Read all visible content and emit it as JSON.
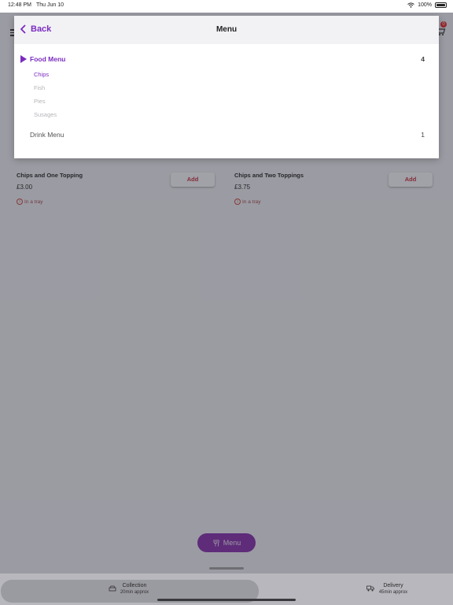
{
  "status_bar": {
    "time": "12:48 PM",
    "date": "Thu Jun 10",
    "battery": "100%"
  },
  "cart": {
    "badge": "0"
  },
  "items": [
    {
      "name": "Chips and One Topping",
      "price": "£3.00",
      "note": "In a tray",
      "add_label": "Add"
    },
    {
      "name": "Chips and Two Toppings",
      "price": "£3.75",
      "note": "In a tray",
      "add_label": "Add"
    }
  ],
  "menu_button": {
    "label": "Menu"
  },
  "bottom_tabs": {
    "collection": {
      "label": "Collection",
      "sub": "20min approx"
    },
    "delivery": {
      "label": "Delivery",
      "sub": "45min approx"
    }
  },
  "menu_panel": {
    "back_label": "Back",
    "title": "Menu",
    "categories": [
      {
        "label": "Food Menu",
        "count": "4",
        "subitems": [
          "Chips",
          "Fish",
          "Pies",
          "Susages"
        ]
      },
      {
        "label": "Drink Menu",
        "count": "1"
      }
    ]
  },
  "colors": {
    "accent": "#7b2cbf",
    "add_text": "#c0202a",
    "fab": "#7b1fa2"
  },
  "icons": [
    "back-chevron-icon",
    "play-triangle-icon",
    "hamburger-icon",
    "cart-icon",
    "fork-icon",
    "collection-icon",
    "delivery-icon",
    "info-icon",
    "wifi-icon",
    "battery-icon"
  ]
}
